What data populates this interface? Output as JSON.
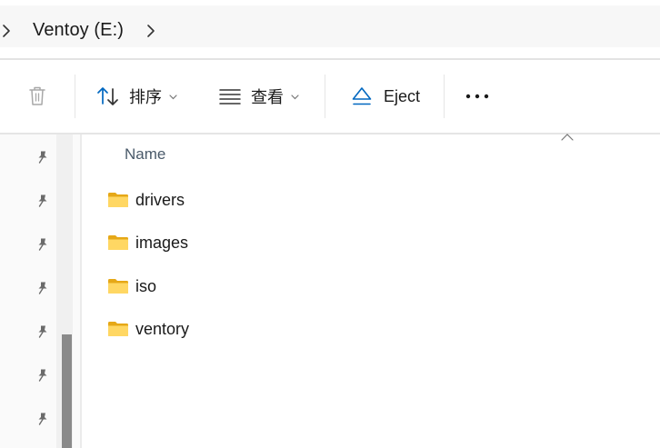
{
  "breadcrumb": {
    "current": "Ventoy (E:)"
  },
  "commandbar": {
    "sort_label": "排序",
    "view_label": "查看",
    "eject_label": "Eject"
  },
  "nav": {
    "pinned_count": 7
  },
  "file_list": {
    "column_name": "Name",
    "items": [
      {
        "name": "drivers",
        "type": "folder"
      },
      {
        "name": "images",
        "type": "folder"
      },
      {
        "name": "iso",
        "type": "folder"
      },
      {
        "name": "ventory",
        "type": "folder"
      }
    ]
  },
  "colors": {
    "accent": "#0067c0",
    "folder": "#f7c948",
    "scroll_thumb": "#8a8a8a"
  }
}
